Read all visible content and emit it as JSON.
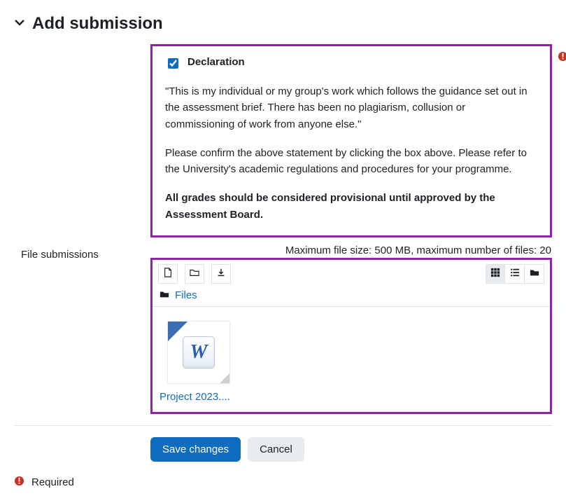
{
  "header": {
    "title": "Add submission"
  },
  "declaration": {
    "label": "Declaration",
    "checked": true,
    "statement": "\"This is my individual or my group's work which follows the guidance set out in the assessment brief. There has been no plagiarism, collusion or commissioning of work from anyone else.\"",
    "instruction": "Please confirm the above statement by clicking the box above. Please refer to the University's academic regulations and procedures for your programme.",
    "provisional": "All grades should be considered provisional until approved by the Assessment Board."
  },
  "file_submissions": {
    "label": "File submissions",
    "limits": "Maximum file size: 500 MB, maximum number of files: 20",
    "breadcrumb_root": "Files",
    "items": [
      {
        "name": "Project 2023...."
      }
    ]
  },
  "actions": {
    "save": "Save changes",
    "cancel": "Cancel"
  },
  "footer": {
    "required": "Required"
  }
}
